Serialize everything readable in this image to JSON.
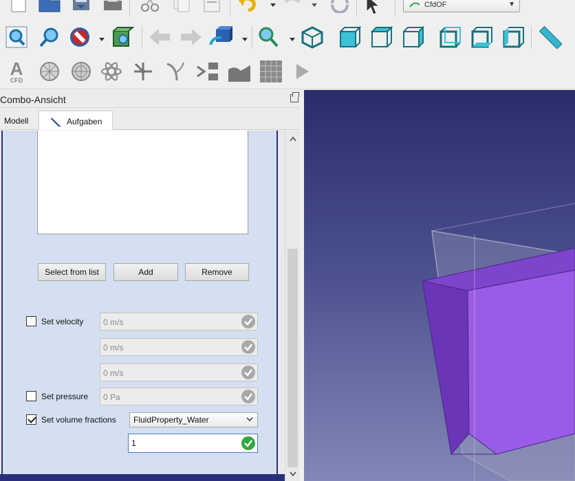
{
  "toolbar": {
    "workbench_label": "CfdOF",
    "row1_icons": [
      "new-document-icon",
      "open-folder-icon",
      "save-icon",
      "print-icon",
      "cut-icon",
      "copy-icon",
      "paste-icon",
      "undo-icon",
      "redo-icon",
      "refresh-icon",
      "whats-this-cursor-icon"
    ],
    "row2_icons": [
      "fit-all-icon",
      "fit-selection-icon",
      "draw-style-icon",
      "bounding-box-icon",
      "back-arrow-icon",
      "forward-arrow-icon",
      "workbench-box-icon",
      "zoom-icon",
      "isometric-view-icon",
      "front-view-icon",
      "top-view-icon",
      "right-view-icon",
      "rear-view-icon",
      "bottom-view-icon",
      "left-view-icon",
      "measure-icon"
    ],
    "row3_icons": [
      "cfd-analysis-icon",
      "mesh-icon",
      "mesh-refine-icon",
      "physics-model-icon",
      "fluid-boundary-icon",
      "initial-conditions-icon",
      "solver-icon",
      "mesh-region-icon",
      "dynamic-mesh-icon",
      "run-icon"
    ],
    "cfd_label_big": "A",
    "cfd_label_small": "CFD"
  },
  "combo": {
    "title": "Combo-Ansicht",
    "tabs": [
      {
        "label": "Modell"
      },
      {
        "label": "Aufgaben"
      }
    ]
  },
  "task": {
    "buttons": {
      "select_from_list": "Select from list",
      "add": "Add",
      "remove": "Remove"
    },
    "velocity": {
      "label": "Set velocity",
      "checked": false,
      "x": "0 m/s",
      "y": "0 m/s",
      "z": "0 m/s"
    },
    "pressure": {
      "label": "Set pressure",
      "checked": false,
      "value": "0 Pa"
    },
    "volume_fractions": {
      "label": "Set volume fractions",
      "checked": true,
      "fluid": "FluidProperty_Water",
      "value": "1"
    }
  },
  "colors": {
    "panel_bg": "#d4dff1",
    "cube_purple": "#8b4fd9",
    "ok_grey": "#a9a9a9",
    "ok_green": "#2fa83c"
  }
}
